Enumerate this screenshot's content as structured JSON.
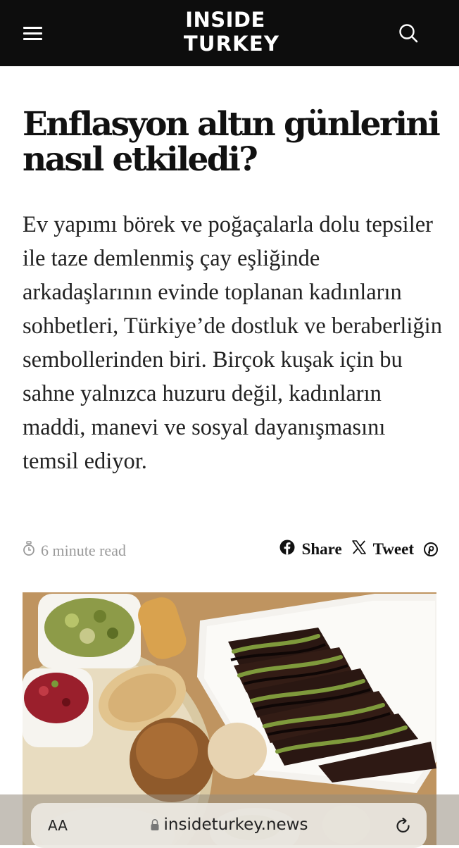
{
  "header": {
    "logo_line1": "INSIDE",
    "logo_line2": "TURKEY",
    "menu_icon": "hamburger-menu-icon",
    "search_icon": "search-icon",
    "background": "#0d0d0d"
  },
  "article": {
    "title": "Enflasyon altın günlerini nasıl etkiledi?",
    "lede": "Ev yapımı börek ve poğaçalarla dolu tepsiler ile taze demlenmiş çay eşliğinde arkadaşlarının evinde toplanan kadınların sohbetleri, Türkiye’de dostluk ve beraberliğin sembollerinden biri. Birçok kuşak için bu sahne yalnızca huzuru değil, kadınların maddi, manevi ve sosyal dayanışmasını temsil ediyor.",
    "read_time": "6 minute read",
    "share_label": "Share",
    "tweet_label": "Tweet",
    "icons": [
      "stopwatch-icon",
      "facebook-icon",
      "x-twitter-icon",
      "pinterest-icon"
    ],
    "hero_image": "food-platter-photo"
  },
  "browser": {
    "text_size_label": "AA",
    "url": "insideturkey.news",
    "icons": [
      "lock-icon",
      "reload-icon"
    ]
  }
}
